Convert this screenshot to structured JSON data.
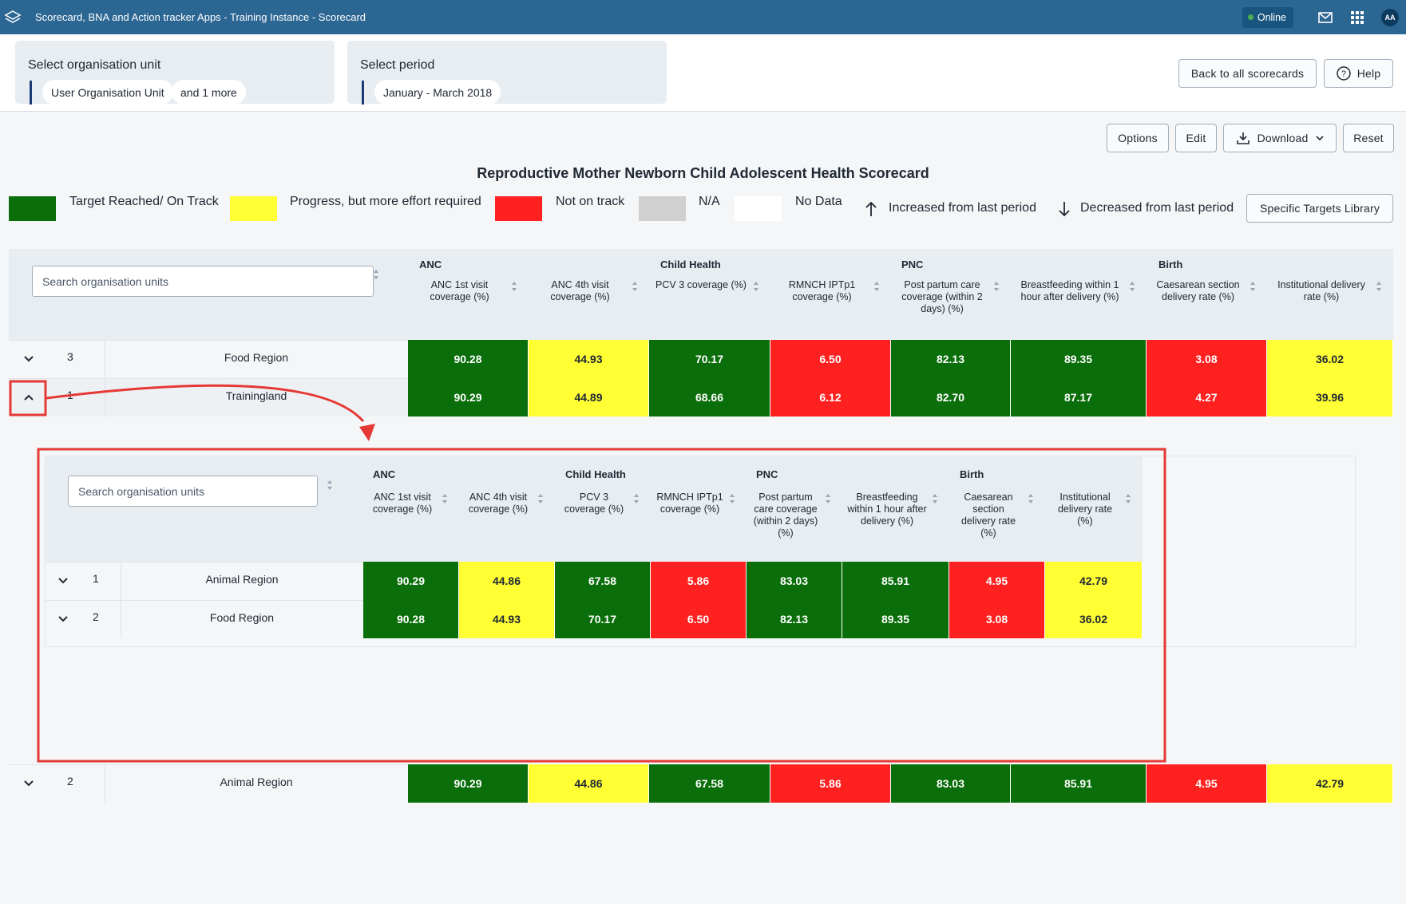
{
  "app": {
    "title": "Scorecard, BNA and Action tracker Apps - Training Instance - Scorecard",
    "online_label": "Online",
    "user_initials": "AA"
  },
  "selection": {
    "org_label": "Select organisation unit",
    "org_chips": [
      "User Organisation Unit",
      "and 1 more"
    ],
    "period_label": "Select period",
    "period_chip": "January - March 2018"
  },
  "actions": {
    "back": "Back to all scorecards",
    "help": "Help",
    "options": "Options",
    "edit": "Edit",
    "download": "Download",
    "reset": "Reset",
    "targets_library": "Specific Targets Library"
  },
  "scorecard_title": "Reproductive Mother Newborn Child Adolescent Health Scorecard",
  "legend": {
    "items": [
      {
        "label": "Target Reached/ On Track",
        "color": "#0a6e0a"
      },
      {
        "label": "Progress, but more effort required",
        "color": "#ffff33"
      },
      {
        "label": "Not on track",
        "color": "#ff2020"
      },
      {
        "label": "N/A",
        "color": "#d0d0d0"
      },
      {
        "label": "No Data",
        "color": "#ffffff"
      }
    ],
    "increased": "Increased from last period",
    "decreased": "Decreased from last period"
  },
  "colors": {
    "header_bg": "#2c6693",
    "green": "#0a6e0a",
    "yellow": "#ffff33",
    "red": "#ff2020",
    "annotation": "#e53935"
  },
  "table": {
    "search_placeholder": "Search organisation units",
    "groups": [
      "ANC",
      "Child Health",
      "PNC",
      "Birth"
    ],
    "columns": [
      "ANC 1st visit coverage (%)",
      "ANC 4th visit coverage (%)",
      "PCV 3 coverage (%)",
      "RMNCH IPTp1 coverage (%)",
      "Post partum care coverage (within 2 days) (%)",
      "Breastfeeding within 1 hour after delivery (%)",
      "Caesarean section delivery rate (%)",
      "Institutional delivery rate (%)"
    ],
    "rows": [
      {
        "num": "3",
        "name": "Food Region",
        "values": [
          "90.28",
          "44.93",
          "70.17",
          "6.50",
          "82.13",
          "89.35",
          "3.08",
          "36.02"
        ],
        "status": [
          "g",
          "y",
          "g",
          "r",
          "g",
          "g",
          "r",
          "y"
        ]
      },
      {
        "num": "1",
        "name": "Trainingland",
        "values": [
          "90.29",
          "44.89",
          "68.66",
          "6.12",
          "82.70",
          "87.17",
          "4.27",
          "39.96"
        ],
        "status": [
          "g",
          "y",
          "g",
          "r",
          "g",
          "g",
          "r",
          "y"
        ]
      },
      {
        "num": "2",
        "name": "Animal Region",
        "values": [
          "90.29",
          "44.86",
          "67.58",
          "5.86",
          "83.03",
          "85.91",
          "4.95",
          "42.79"
        ],
        "status": [
          "g",
          "y",
          "g",
          "r",
          "g",
          "g",
          "r",
          "y"
        ]
      }
    ]
  },
  "subtable": {
    "search_placeholder": "Search organisation units",
    "groups": [
      "ANC",
      "Child Health",
      "PNC",
      "Birth"
    ],
    "columns": [
      "ANC 1st visit coverage (%)",
      "ANC 4th visit coverage (%)",
      "PCV 3 coverage (%)",
      "RMNCH IPTp1 coverage (%)",
      "Post partum care coverage (within 2 days) (%)",
      "Breastfeeding within 1 hour after delivery (%)",
      "Caesarean section delivery rate (%)",
      "Institutional delivery rate (%)"
    ],
    "rows": [
      {
        "num": "1",
        "name": "Animal Region",
        "values": [
          "90.29",
          "44.86",
          "67.58",
          "5.86",
          "83.03",
          "85.91",
          "4.95",
          "42.79"
        ],
        "status": [
          "g",
          "y",
          "g",
          "r",
          "g",
          "g",
          "r",
          "y"
        ]
      },
      {
        "num": "2",
        "name": "Food Region",
        "values": [
          "90.28",
          "44.93",
          "70.17",
          "6.50",
          "82.13",
          "89.35",
          "3.08",
          "36.02"
        ],
        "status": [
          "g",
          "y",
          "g",
          "r",
          "g",
          "g",
          "r",
          "y"
        ]
      }
    ]
  }
}
